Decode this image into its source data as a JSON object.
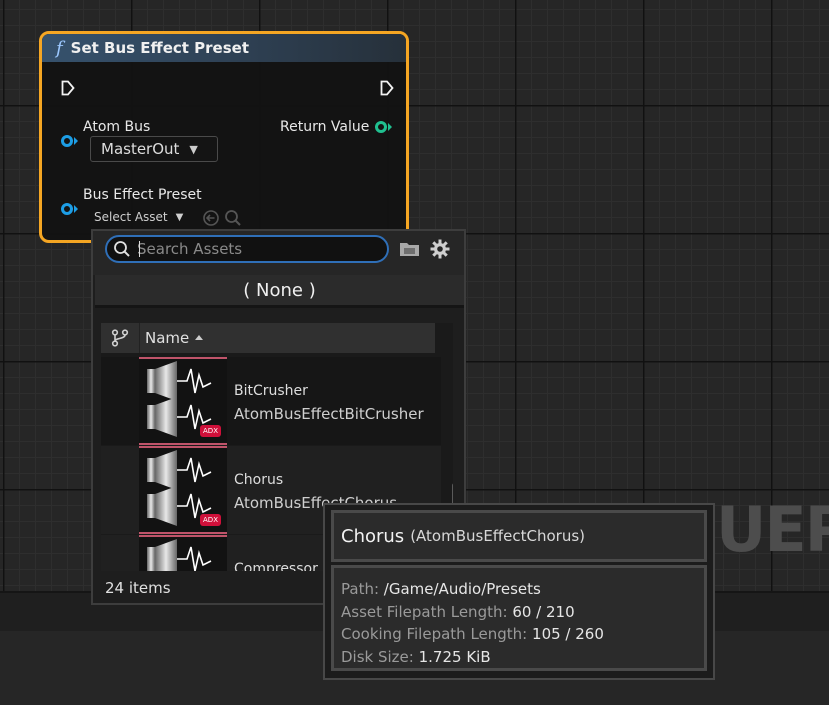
{
  "node": {
    "title": "Set Bus Effect Preset",
    "inputs": {
      "atom_bus_label": "Atom Bus",
      "atom_bus_value": "MasterOut",
      "bus_effect_preset_label": "Bus Effect Preset",
      "select_asset_label": "Select Asset"
    },
    "outputs": {
      "return_value_label": "Return Value"
    },
    "colors": {
      "border": "#f5a623",
      "pin_object": "#1d9ee6",
      "pin_return": "#20c090"
    }
  },
  "picker": {
    "search_placeholder": "Search Assets",
    "none_option": "( None )",
    "column_name": "Name",
    "items": [
      {
        "name": "BitCrusher",
        "class": "AtomBusEffectBitCrusher",
        "badge": "ADX"
      },
      {
        "name": "Chorus",
        "class": "AtomBusEffectChorus",
        "badge": "ADX"
      },
      {
        "name": "Compressor",
        "class": ""
      }
    ],
    "items_count": "24 items"
  },
  "tooltip": {
    "title": "Chorus",
    "class_name": "(AtomBusEffectChorus)",
    "path_label": "Path:",
    "path_value": "/Game/Audio/Presets",
    "asset_len_label": "Asset Filepath Length:",
    "asset_len_value": "60 / 210",
    "cook_len_label": "Cooking Filepath Length:",
    "cook_len_value": "105 / 260",
    "disk_label": "Disk Size:",
    "disk_value": "1.725 KiB"
  },
  "watermark": "UEP"
}
